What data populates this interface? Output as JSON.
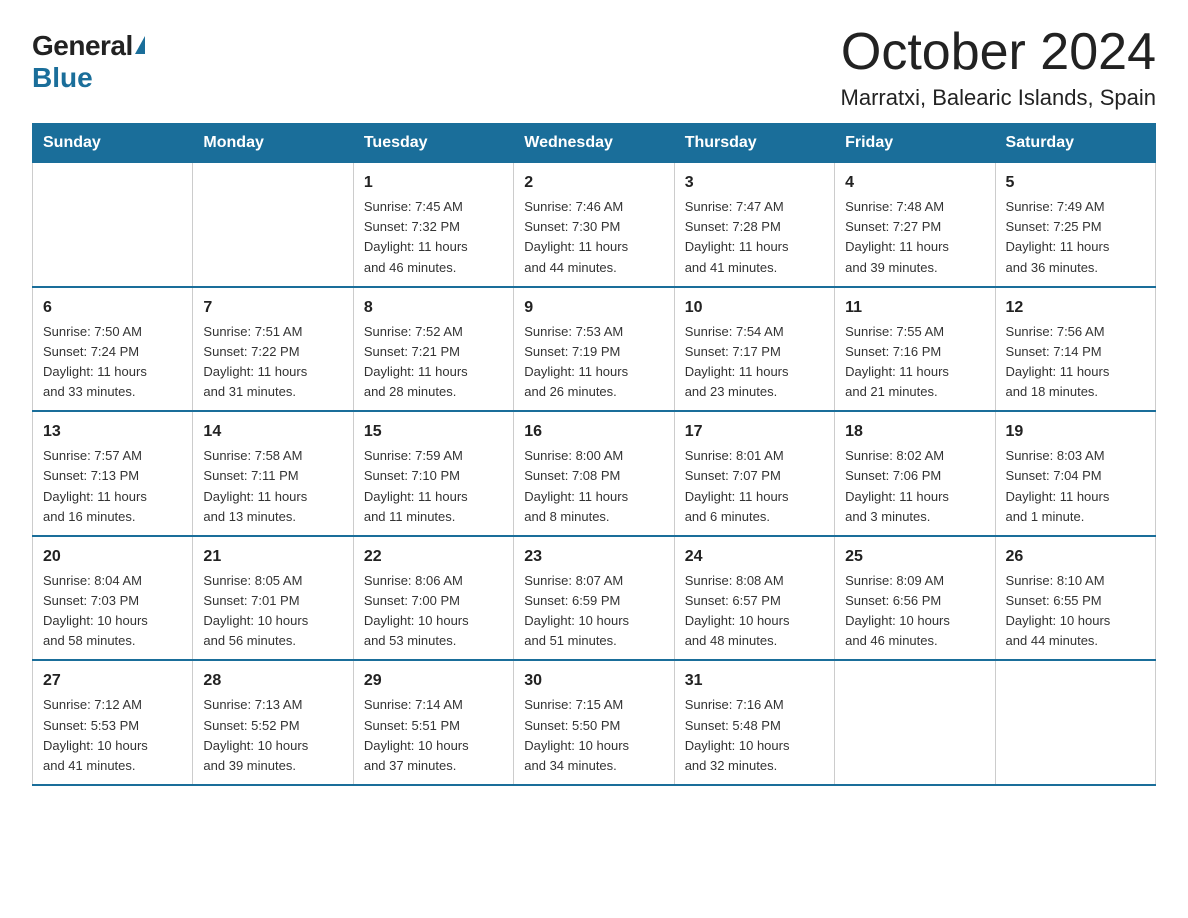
{
  "logo": {
    "general": "General",
    "blue": "Blue"
  },
  "title": "October 2024",
  "subtitle": "Marratxi, Balearic Islands, Spain",
  "days_of_week": [
    "Sunday",
    "Monday",
    "Tuesday",
    "Wednesday",
    "Thursday",
    "Friday",
    "Saturday"
  ],
  "weeks": [
    [
      {
        "day": "",
        "info": ""
      },
      {
        "day": "",
        "info": ""
      },
      {
        "day": "1",
        "info": "Sunrise: 7:45 AM\nSunset: 7:32 PM\nDaylight: 11 hours\nand 46 minutes."
      },
      {
        "day": "2",
        "info": "Sunrise: 7:46 AM\nSunset: 7:30 PM\nDaylight: 11 hours\nand 44 minutes."
      },
      {
        "day": "3",
        "info": "Sunrise: 7:47 AM\nSunset: 7:28 PM\nDaylight: 11 hours\nand 41 minutes."
      },
      {
        "day": "4",
        "info": "Sunrise: 7:48 AM\nSunset: 7:27 PM\nDaylight: 11 hours\nand 39 minutes."
      },
      {
        "day": "5",
        "info": "Sunrise: 7:49 AM\nSunset: 7:25 PM\nDaylight: 11 hours\nand 36 minutes."
      }
    ],
    [
      {
        "day": "6",
        "info": "Sunrise: 7:50 AM\nSunset: 7:24 PM\nDaylight: 11 hours\nand 33 minutes."
      },
      {
        "day": "7",
        "info": "Sunrise: 7:51 AM\nSunset: 7:22 PM\nDaylight: 11 hours\nand 31 minutes."
      },
      {
        "day": "8",
        "info": "Sunrise: 7:52 AM\nSunset: 7:21 PM\nDaylight: 11 hours\nand 28 minutes."
      },
      {
        "day": "9",
        "info": "Sunrise: 7:53 AM\nSunset: 7:19 PM\nDaylight: 11 hours\nand 26 minutes."
      },
      {
        "day": "10",
        "info": "Sunrise: 7:54 AM\nSunset: 7:17 PM\nDaylight: 11 hours\nand 23 minutes."
      },
      {
        "day": "11",
        "info": "Sunrise: 7:55 AM\nSunset: 7:16 PM\nDaylight: 11 hours\nand 21 minutes."
      },
      {
        "day": "12",
        "info": "Sunrise: 7:56 AM\nSunset: 7:14 PM\nDaylight: 11 hours\nand 18 minutes."
      }
    ],
    [
      {
        "day": "13",
        "info": "Sunrise: 7:57 AM\nSunset: 7:13 PM\nDaylight: 11 hours\nand 16 minutes."
      },
      {
        "day": "14",
        "info": "Sunrise: 7:58 AM\nSunset: 7:11 PM\nDaylight: 11 hours\nand 13 minutes."
      },
      {
        "day": "15",
        "info": "Sunrise: 7:59 AM\nSunset: 7:10 PM\nDaylight: 11 hours\nand 11 minutes."
      },
      {
        "day": "16",
        "info": "Sunrise: 8:00 AM\nSunset: 7:08 PM\nDaylight: 11 hours\nand 8 minutes."
      },
      {
        "day": "17",
        "info": "Sunrise: 8:01 AM\nSunset: 7:07 PM\nDaylight: 11 hours\nand 6 minutes."
      },
      {
        "day": "18",
        "info": "Sunrise: 8:02 AM\nSunset: 7:06 PM\nDaylight: 11 hours\nand 3 minutes."
      },
      {
        "day": "19",
        "info": "Sunrise: 8:03 AM\nSunset: 7:04 PM\nDaylight: 11 hours\nand 1 minute."
      }
    ],
    [
      {
        "day": "20",
        "info": "Sunrise: 8:04 AM\nSunset: 7:03 PM\nDaylight: 10 hours\nand 58 minutes."
      },
      {
        "day": "21",
        "info": "Sunrise: 8:05 AM\nSunset: 7:01 PM\nDaylight: 10 hours\nand 56 minutes."
      },
      {
        "day": "22",
        "info": "Sunrise: 8:06 AM\nSunset: 7:00 PM\nDaylight: 10 hours\nand 53 minutes."
      },
      {
        "day": "23",
        "info": "Sunrise: 8:07 AM\nSunset: 6:59 PM\nDaylight: 10 hours\nand 51 minutes."
      },
      {
        "day": "24",
        "info": "Sunrise: 8:08 AM\nSunset: 6:57 PM\nDaylight: 10 hours\nand 48 minutes."
      },
      {
        "day": "25",
        "info": "Sunrise: 8:09 AM\nSunset: 6:56 PM\nDaylight: 10 hours\nand 46 minutes."
      },
      {
        "day": "26",
        "info": "Sunrise: 8:10 AM\nSunset: 6:55 PM\nDaylight: 10 hours\nand 44 minutes."
      }
    ],
    [
      {
        "day": "27",
        "info": "Sunrise: 7:12 AM\nSunset: 5:53 PM\nDaylight: 10 hours\nand 41 minutes."
      },
      {
        "day": "28",
        "info": "Sunrise: 7:13 AM\nSunset: 5:52 PM\nDaylight: 10 hours\nand 39 minutes."
      },
      {
        "day": "29",
        "info": "Sunrise: 7:14 AM\nSunset: 5:51 PM\nDaylight: 10 hours\nand 37 minutes."
      },
      {
        "day": "30",
        "info": "Sunrise: 7:15 AM\nSunset: 5:50 PM\nDaylight: 10 hours\nand 34 minutes."
      },
      {
        "day": "31",
        "info": "Sunrise: 7:16 AM\nSunset: 5:48 PM\nDaylight: 10 hours\nand 32 minutes."
      },
      {
        "day": "",
        "info": ""
      },
      {
        "day": "",
        "info": ""
      }
    ]
  ]
}
